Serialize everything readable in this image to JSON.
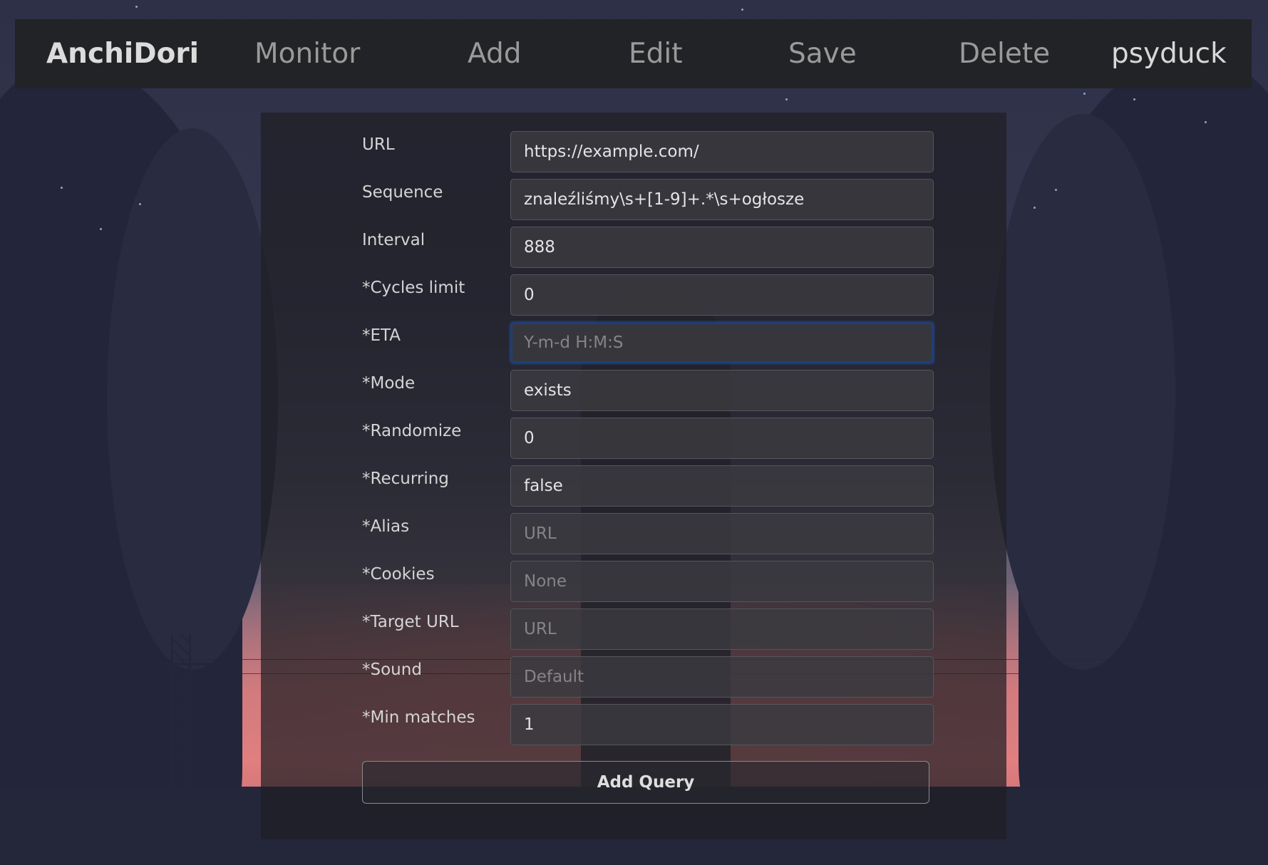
{
  "nav": {
    "brand": "AnchiDori",
    "links": {
      "monitor": "Monitor",
      "add": "Add",
      "edit": "Edit",
      "save": "Save",
      "delete": "Delete"
    },
    "user": "psyduck"
  },
  "form": {
    "fields": [
      {
        "label": "URL",
        "value": "https://example.com/",
        "placeholder": ""
      },
      {
        "label": "Sequence",
        "value": "znaleźliśmy\\s+[1-9]+.*\\s+ogłosze",
        "placeholder": ""
      },
      {
        "label": "Interval",
        "value": "888",
        "placeholder": ""
      },
      {
        "label": "*Cycles limit",
        "value": "0",
        "placeholder": ""
      },
      {
        "label": "*ETA",
        "value": "",
        "placeholder": "Y-m-d H:M:S"
      },
      {
        "label": "*Mode",
        "value": "exists",
        "placeholder": ""
      },
      {
        "label": "*Randomize",
        "value": "0",
        "placeholder": ""
      },
      {
        "label": "*Recurring",
        "value": "false",
        "placeholder": ""
      },
      {
        "label": "*Alias",
        "value": "",
        "placeholder": "URL"
      },
      {
        "label": "*Cookies",
        "value": "",
        "placeholder": "None"
      },
      {
        "label": "*Target URL",
        "value": "",
        "placeholder": "URL"
      },
      {
        "label": "*Sound",
        "value": "",
        "placeholder": "Default"
      },
      {
        "label": "*Min matches",
        "value": "1",
        "placeholder": ""
      }
    ],
    "submit_label": "Add Query"
  },
  "colors": {
    "navbar_bg": "#222326",
    "focus_border": "#1f3f78",
    "panel_bg": "rgba(30,31,36,0.72)"
  }
}
